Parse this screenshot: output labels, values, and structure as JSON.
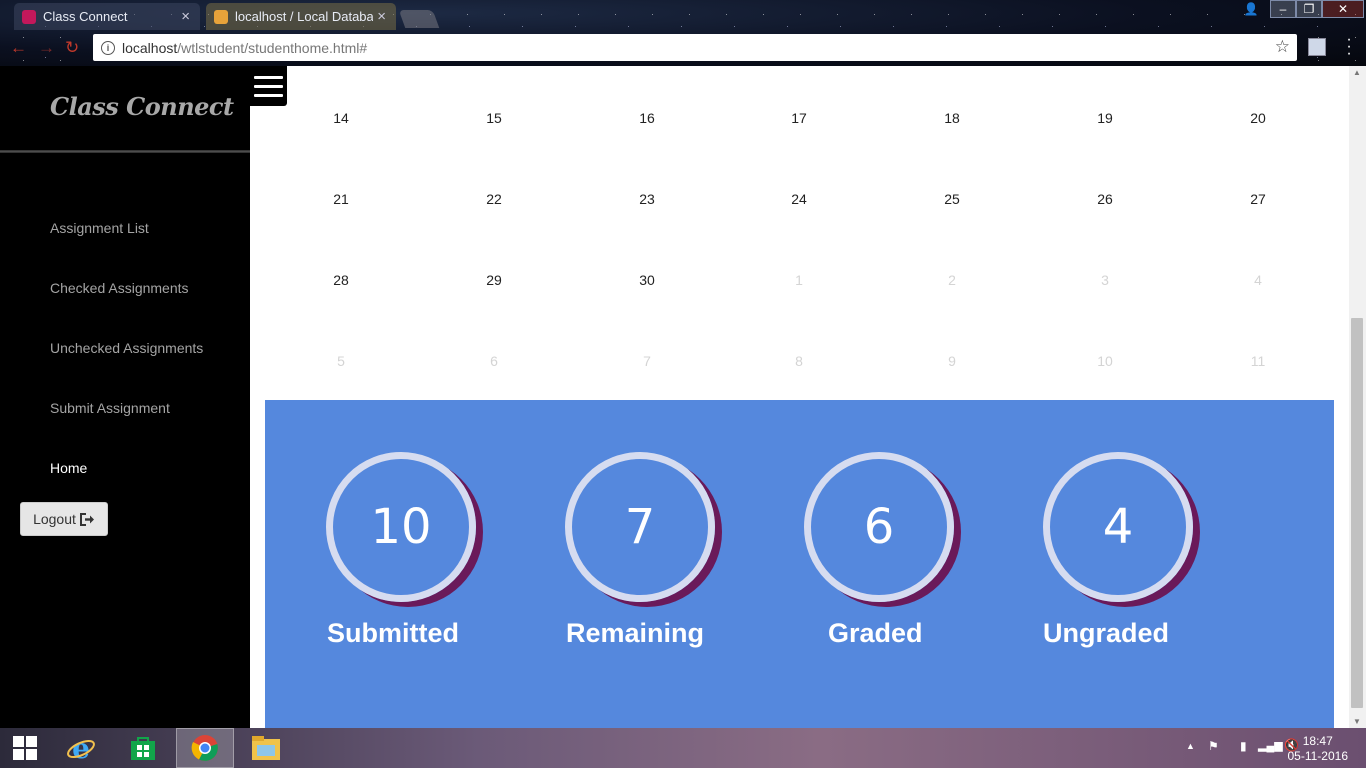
{
  "browser": {
    "tabs": [
      {
        "title": "Class Connect",
        "close": "×",
        "favicon_color": "#c2185b"
      },
      {
        "title": "localhost / Local Databa",
        "close": "×",
        "favicon_color": "#e8a33a"
      }
    ],
    "url_host": "localhost",
    "url_path": "/wtlstudent/studenthome.html#",
    "window_controls": {
      "minimize": "–",
      "maximize": "❐",
      "close": "✕"
    }
  },
  "sidebar": {
    "brand": "Class Connect",
    "items": [
      {
        "label": "Assignment List"
      },
      {
        "label": "Checked Assignments"
      },
      {
        "label": "Unchecked Assignments"
      },
      {
        "label": "Submit Assignment"
      },
      {
        "label": "Home",
        "active": true
      }
    ],
    "logout_label": "Logout"
  },
  "calendar": {
    "rows": [
      [
        {
          "d": "14"
        },
        {
          "d": "15"
        },
        {
          "d": "16"
        },
        {
          "d": "17"
        },
        {
          "d": "18"
        },
        {
          "d": "19"
        },
        {
          "d": "20"
        }
      ],
      [
        {
          "d": "21"
        },
        {
          "d": "22"
        },
        {
          "d": "23"
        },
        {
          "d": "24"
        },
        {
          "d": "25"
        },
        {
          "d": "26"
        },
        {
          "d": "27"
        }
      ],
      [
        {
          "d": "28"
        },
        {
          "d": "29"
        },
        {
          "d": "30"
        },
        {
          "d": "1",
          "muted": true
        },
        {
          "d": "2",
          "muted": true
        },
        {
          "d": "3",
          "muted": true
        },
        {
          "d": "4",
          "muted": true
        }
      ],
      [
        {
          "d": "5",
          "muted": true
        },
        {
          "d": "6",
          "muted": true
        },
        {
          "d": "7",
          "muted": true
        },
        {
          "d": "8",
          "muted": true
        },
        {
          "d": "9",
          "muted": true
        },
        {
          "d": "10",
          "muted": true
        },
        {
          "d": "11",
          "muted": true
        }
      ]
    ]
  },
  "stats": [
    {
      "value": "10",
      "label": "Submitted"
    },
    {
      "value": "7",
      "label": "Remaining"
    },
    {
      "value": "6",
      "label": "Graded"
    },
    {
      "value": "4",
      "label": "Ungraded"
    }
  ],
  "colors": {
    "stats_background": "#5588dd",
    "ring": "#d6dcf0",
    "ring_shadow": "#6a1a5a",
    "sidebar": "#000000"
  },
  "taskbar": {
    "pinned": [
      "windows-start-icon",
      "internet-explorer-icon",
      "store-icon",
      "chrome-icon",
      "file-explorer-icon"
    ],
    "time": "18:47",
    "date": "05-11-2016"
  }
}
